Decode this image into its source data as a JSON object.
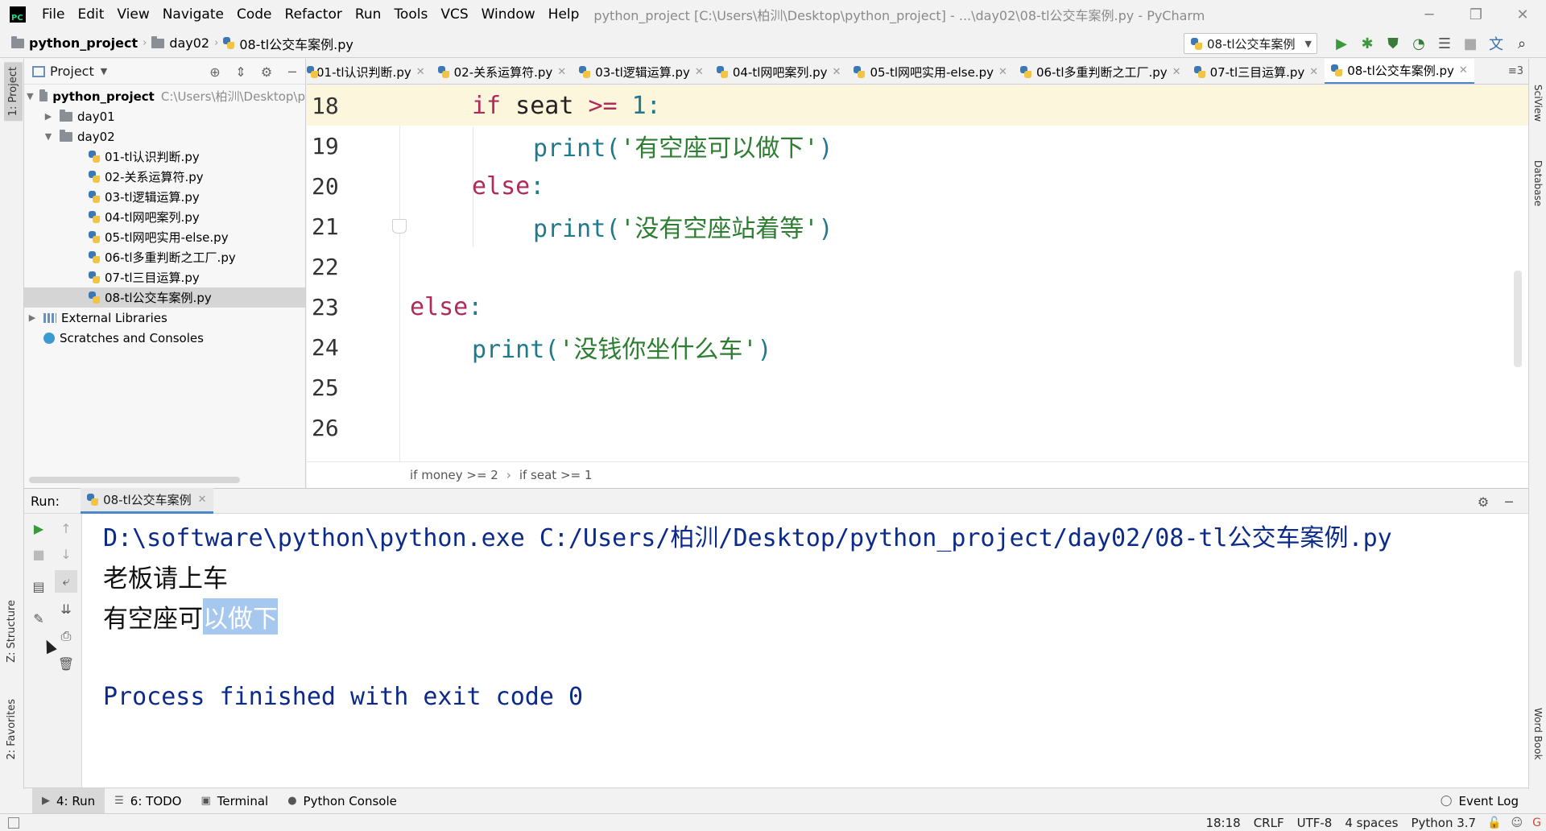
{
  "menu": {
    "items": [
      "File",
      "Edit",
      "View",
      "Navigate",
      "Code",
      "Refactor",
      "Run",
      "Tools",
      "VCS",
      "Window",
      "Help"
    ],
    "window_title": "python_project [C:\\Users\\柏汌\\Desktop\\python_project] - ...\\day02\\08-tl公交车案例.py - PyCharm"
  },
  "nav": {
    "crumbs": [
      "python_project",
      "day02",
      "08-tl公交车案例.py"
    ],
    "run_config": "08-tl公交车案例"
  },
  "left_stripe": {
    "project": "1: Project",
    "structure": "Z: Structure",
    "favorites": "2: Favorites"
  },
  "right_stripe": {
    "sciview": "SciView",
    "database": "Database",
    "wordbook": "Word Book"
  },
  "project_panel": {
    "title": "Project",
    "root": {
      "name": "python_project",
      "path": "C:\\Users\\柏汌\\Desktop\\p"
    },
    "folders": [
      "day01",
      "day02"
    ],
    "files": [
      "01-tl认识判断.py",
      "02-关系运算符.py",
      "03-tl逻辑运算.py",
      "04-tl网吧案列.py",
      "05-tl网吧实用-else.py",
      "06-tl多重判断之工厂.py",
      "07-tl三目运算.py",
      "08-tl公交车案例.py"
    ],
    "external_libraries": "External Libraries",
    "scratches": "Scratches and Consoles"
  },
  "editor_tabs": [
    "01-tl认识判断.py",
    "02-关系运算符.py",
    "03-tl逻辑运算.py",
    "04-tl网吧案列.py",
    "05-tl网吧实用-else.py",
    "06-tl多重判断之工厂.py",
    "07-tl三目运算.py",
    "08-tl公交车案例.py"
  ],
  "tabs_more": "≡3",
  "code": {
    "line_numbers": [
      "18",
      "19",
      "20",
      "21",
      "22",
      "23",
      "24",
      "25",
      "26"
    ],
    "l18": {
      "kw": "if",
      "var": " seat ",
      "op": ">=",
      "num": " 1",
      "colon": ":"
    },
    "l19": {
      "fn": "print",
      "open": "(",
      "str": "'有空座可以做下'",
      "close": ")"
    },
    "l20": {
      "kw": "else",
      "colon": ":"
    },
    "l21": {
      "fn": "print",
      "open": "(",
      "str": "'没有空座站着等'",
      "close": ")"
    },
    "l23": {
      "kw": "else",
      "colon": ":"
    },
    "l24": {
      "fn": "print",
      "open": "(",
      "str": "'没钱你坐什么车'",
      "close": ")"
    }
  },
  "code_breadcrumb": [
    "if money >= 2",
    "if seat >= 1"
  ],
  "run_panel": {
    "label": "Run:",
    "tab": "08-tl公交车案例",
    "command": "D:\\software\\python\\python.exe C:/Users/柏汌/Desktop/python_project/day02/08-tl公交车案例.py",
    "output1": "老板请上车",
    "output2_plain": "有空座可",
    "output2_selected": "以做下",
    "exit": "Process finished with exit code 0"
  },
  "tool_strip": {
    "run": "4: Run",
    "todo": "6: TODO",
    "terminal": "Terminal",
    "python_console": "Python Console",
    "event_log": "Event Log"
  },
  "status": {
    "position": "18:18",
    "line_sep": "CRLF",
    "encoding": "UTF-8",
    "indent": "4 spaces",
    "interpreter": "Python 3.7"
  }
}
